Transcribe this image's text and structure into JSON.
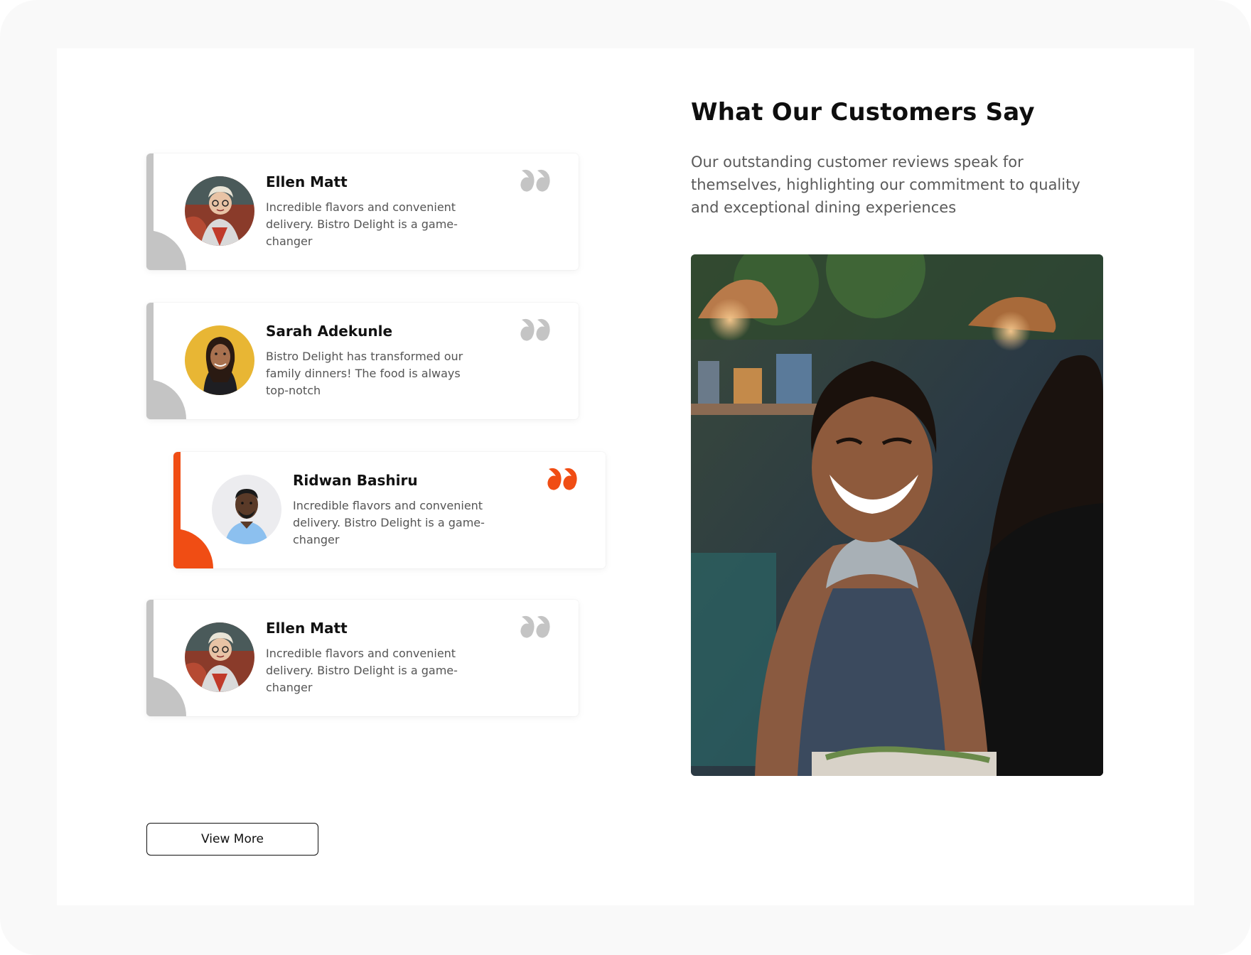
{
  "section": {
    "heading": "What Our Customers Say",
    "intro": "Our outstanding customer reviews speak for themselves, highlighting our commitment to quality and exceptional dining experiences"
  },
  "testimonials": [
    {
      "name": "Ellen Matt",
      "review": "Incredible flavors and convenient delivery. Bistro Delight is a game-changer",
      "active": false
    },
    {
      "name": "Sarah Adekunle",
      "review": "Bistro Delight has transformed our family dinners! The food is always top-notch",
      "active": false
    },
    {
      "name": "Ridwan Bashiru",
      "review": "Incredible flavors and convenient delivery. Bistro Delight is a game-changer",
      "active": true
    },
    {
      "name": "Ellen Matt",
      "review": "Incredible flavors and convenient delivery. Bistro Delight is a game-changer",
      "active": false
    }
  ],
  "actions": {
    "view_more_label": "View More"
  },
  "colors": {
    "accent": "#f04d14",
    "inactive": "#c4c4c4"
  },
  "icons": {
    "quote": "quote-icon",
    "avatar": "avatar"
  }
}
